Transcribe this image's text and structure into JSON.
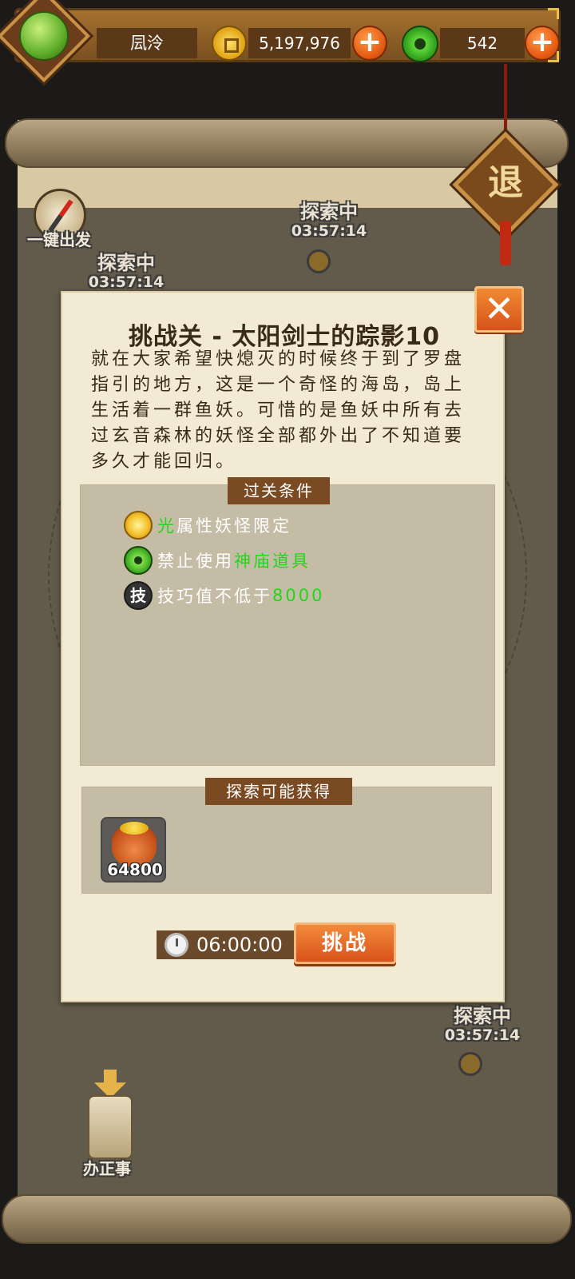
{
  "topbar": {
    "player_name": "凨泠",
    "coins": "5,197,976",
    "jade": "542",
    "plus_label": "+"
  },
  "side": {
    "quick_dispatch_label": "一键出发",
    "retreat_label": "退",
    "task_label": "办正事"
  },
  "map": {
    "explore_tags": [
      {
        "label": "探索中",
        "time": "03:57:14"
      },
      {
        "label": "探索中",
        "time": "03:57:14"
      },
      {
        "label": "探索中",
        "time": "03:57:14"
      }
    ]
  },
  "modal": {
    "close_label": "✕",
    "title": "挑战关 - 太阳剑士的踪影10",
    "description": "就在大家希望快熄灭的时候终于到了罗盘指引的地方，这是一个奇怪的海岛，岛上生活着一群鱼妖。可惜的是鱼妖中所有去过玄音森林的妖怪全部都外出了不知道要多久才能回归。",
    "conditions_title": "过关条件",
    "conditions": [
      {
        "icon": "sun-icon",
        "highlight": "光",
        "text": "属性妖怪限定"
      },
      {
        "icon": "jade-icon",
        "text": "禁止使用",
        "highlight": "神庙道具"
      },
      {
        "icon": "skill-icon",
        "icon_text": "技",
        "text": "技巧值不低于",
        "highlight": "8000"
      }
    ],
    "rewards_title": "探索可能获得",
    "rewards": [
      {
        "icon": "coin-bag-icon",
        "count": "64800"
      }
    ],
    "timer": "06:00:00",
    "challenge_label": "挑战"
  },
  "colors": {
    "accent_orange": "#d9521a",
    "highlight_green": "#22d61e",
    "panel_brown": "#7a4a22"
  }
}
